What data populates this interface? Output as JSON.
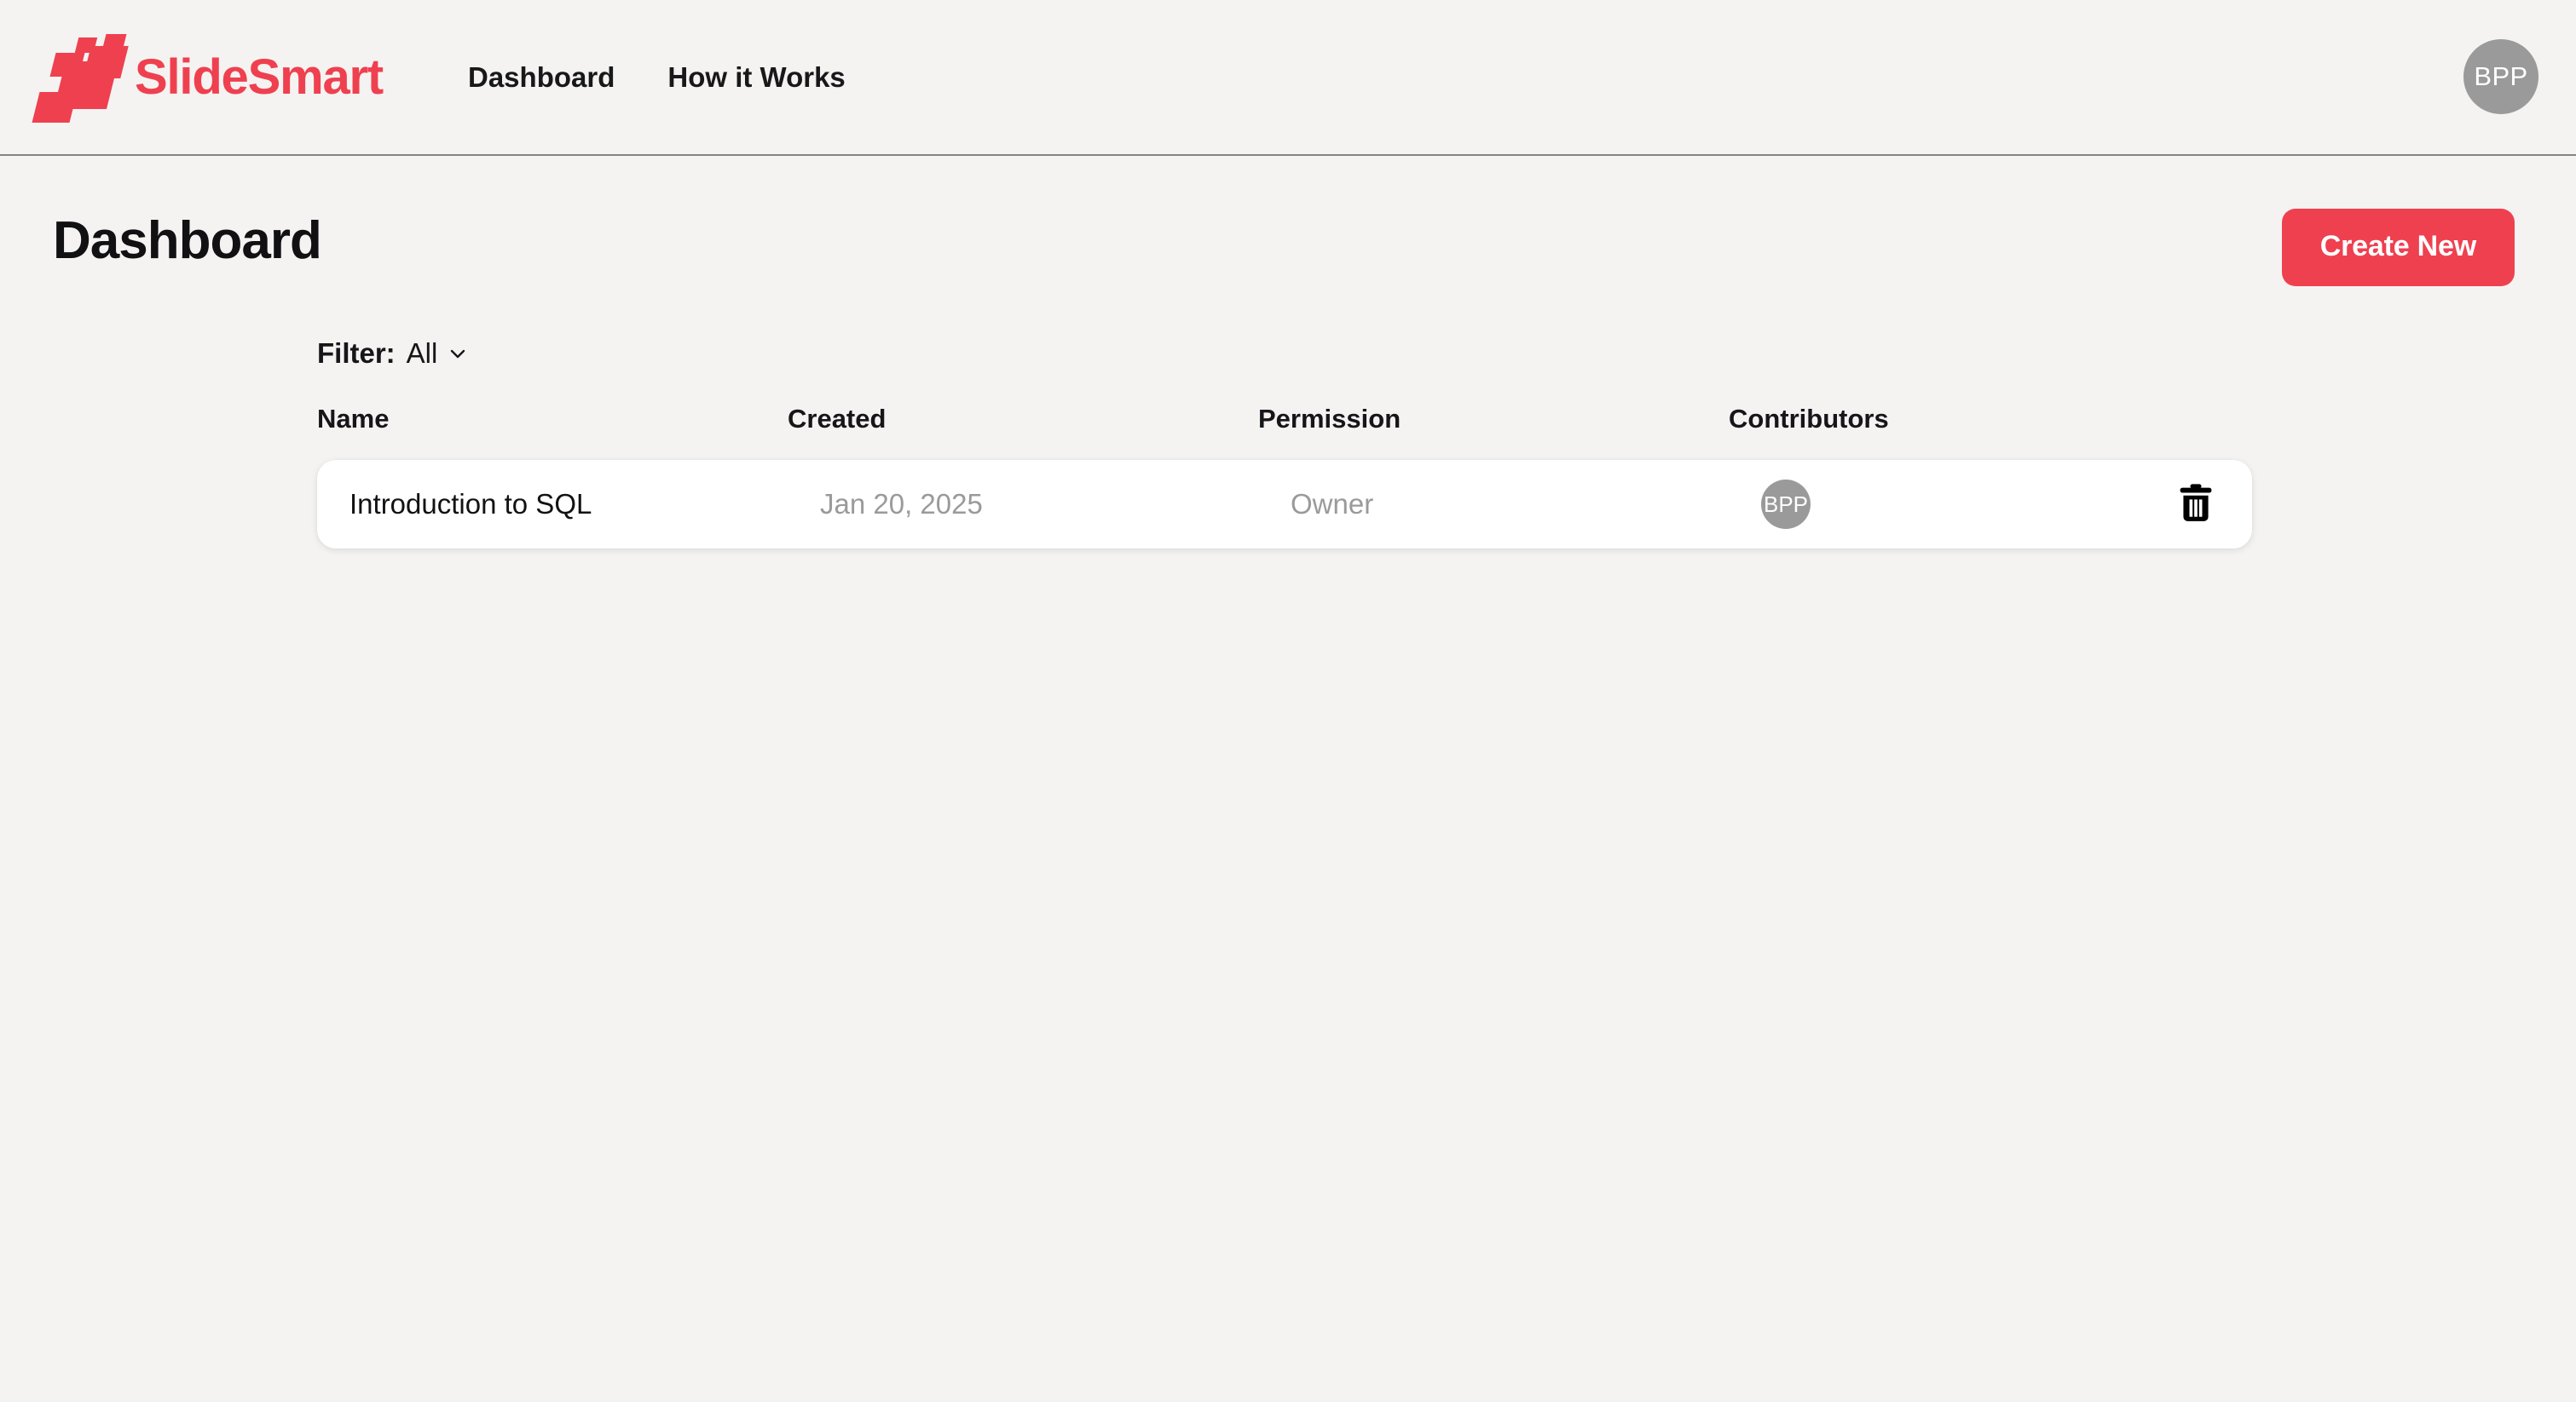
{
  "brand": {
    "name": "SlideSmart",
    "logo_icon": "slide-cascade-icon",
    "accent_color": "#ef4050"
  },
  "nav": {
    "links": [
      {
        "label": "Dashboard"
      },
      {
        "label": "How it Works"
      }
    ],
    "avatar": {
      "initials": "BPP",
      "color": "#9a9a9a"
    }
  },
  "page": {
    "title": "Dashboard",
    "create_button": "Create New"
  },
  "filter": {
    "label": "Filter:",
    "value": "All",
    "chevron_icon": "chevron-down-icon"
  },
  "table": {
    "headers": [
      "Name",
      "Created",
      "Permission",
      "Contributors"
    ],
    "rows": [
      {
        "name": "Introduction to SQL",
        "created": "Jan 20, 2025",
        "permission": "Owner",
        "contributors": [
          {
            "initials": "BPP"
          }
        ],
        "delete_icon": "trash-icon"
      }
    ]
  },
  "colors": {
    "background": "#f4f3f1",
    "card": "#ffffff",
    "accent": "#ef4050",
    "muted_text": "#9a9a9a",
    "text": "#16161a"
  }
}
